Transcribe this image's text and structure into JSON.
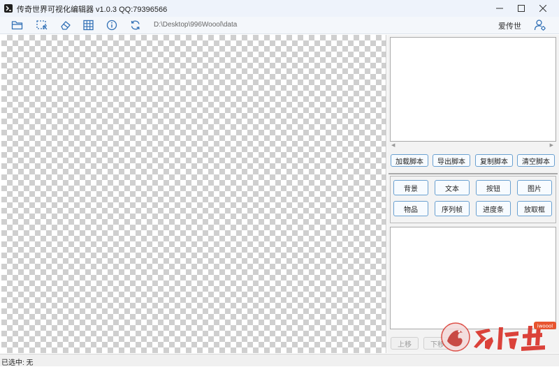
{
  "window": {
    "title": "传奇世界可视化编辑器 v1.0.3 QQ:79396566",
    "icon": "app-logo-icon",
    "controls": [
      "minimize-icon",
      "maximize-icon",
      "close-icon"
    ]
  },
  "toolbar": {
    "tools": [
      "folder-open-icon",
      "select-region-icon",
      "eraser-icon",
      "grid-icon",
      "info-icon",
      "refresh-icon"
    ],
    "path": "D:\\Desktop\\996Woool\\data",
    "user_label": "爱传世",
    "user_icon": "user-settings-icon"
  },
  "script_panel": {
    "buttons": [
      "加载脚本",
      "导出脚本",
      "复制脚本",
      "清空脚本"
    ]
  },
  "components": {
    "row1": [
      "背景",
      "文本",
      "按钮",
      "图片"
    ],
    "row2": [
      "物品",
      "序列帧",
      "进度条",
      "放取框"
    ]
  },
  "properties": {
    "buttons": [
      "上移",
      "下移"
    ]
  },
  "watermark": {
    "text": "爱传世",
    "badge": "iwoool"
  },
  "status": {
    "selected": "已选中: 无"
  },
  "colors": {
    "accent": "#6aa0d0",
    "icon": "#2f6fb5",
    "watermark": "#d9342b"
  }
}
